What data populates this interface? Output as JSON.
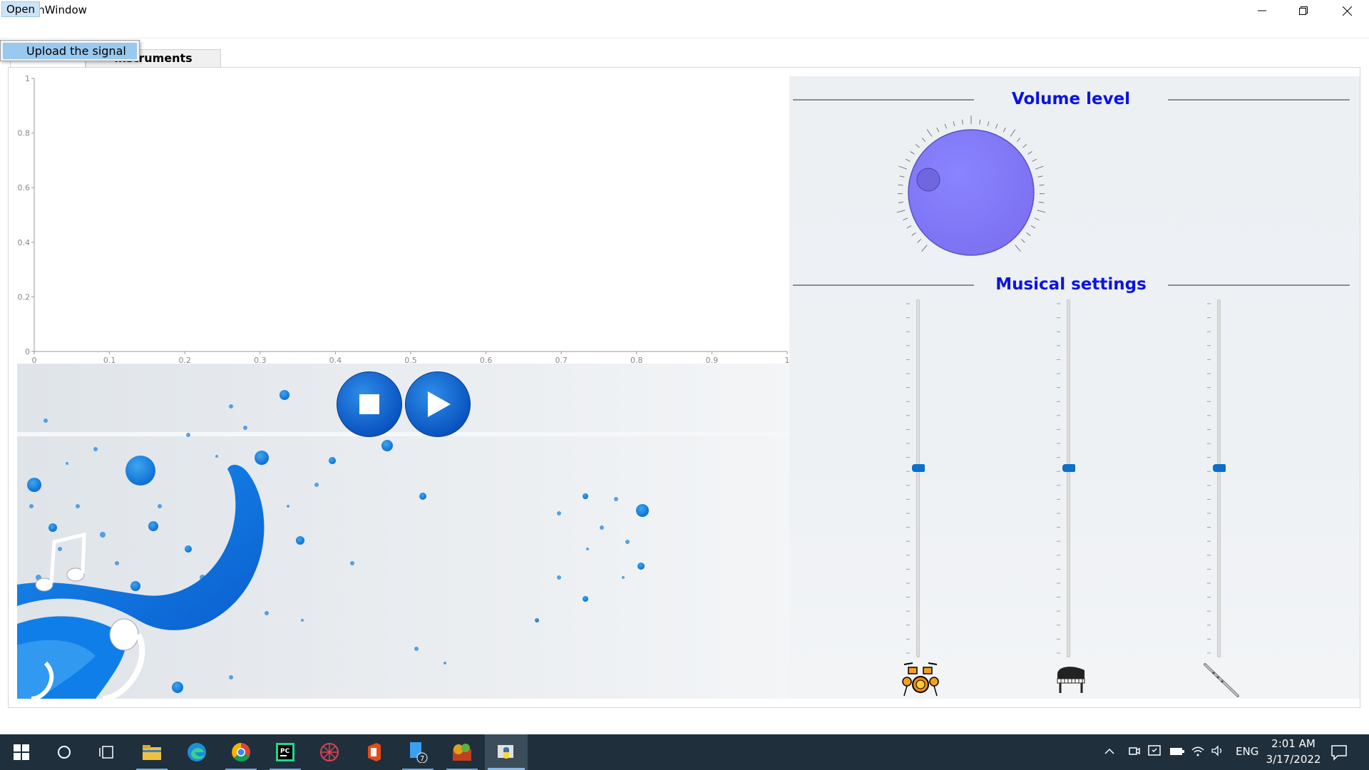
{
  "window": {
    "title": "MainWindow"
  },
  "menubar": {
    "open_label": "Open",
    "dropdown_items": [
      "Upload the signal"
    ]
  },
  "tabs": [
    {
      "label": ""
    },
    {
      "label": "instruments"
    }
  ],
  "plot": {
    "x_ticks": [
      "0",
      "0.1",
      "0.2",
      "0.3",
      "0.4",
      "0.5",
      "0.6",
      "0.7",
      "0.8",
      "0.9",
      "1"
    ],
    "y_ticks": [
      "0",
      "0.2",
      "0.4",
      "0.6",
      "0.8",
      "1"
    ]
  },
  "volume": {
    "title": "Volume level"
  },
  "musical": {
    "title": "Musical settings",
    "sliders": [
      {
        "instrument_icon": "drums-icon",
        "level": 0.5
      },
      {
        "instrument_icon": "piano-icon",
        "level": 0.5
      },
      {
        "instrument_icon": "flute-icon",
        "level": 0.5
      }
    ]
  },
  "taskbar": {
    "lang": "ENG",
    "time": "2:01 AM",
    "date": "3/17/2022",
    "badge": "7"
  },
  "colors": {
    "accent_blue": "#0b14e0",
    "knob": "#7a6ff0",
    "slider_handle": "#0d6fcc",
    "taskbar": "#1f2f3c"
  }
}
